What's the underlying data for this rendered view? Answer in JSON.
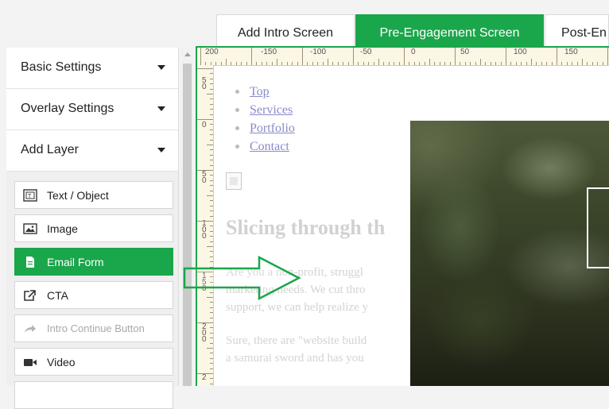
{
  "tabs": [
    {
      "label": "Add Intro Screen",
      "active": false
    },
    {
      "label": "Pre-Engagement Screen",
      "active": true
    },
    {
      "label": "Post-En",
      "active": false
    }
  ],
  "sidebar": {
    "sections": [
      {
        "label": "Basic Settings"
      },
      {
        "label": "Overlay Settings"
      },
      {
        "label": "Add Layer"
      }
    ],
    "layers": [
      {
        "label": "Text / Object",
        "icon": "text-object-icon",
        "state": "normal"
      },
      {
        "label": "Image",
        "icon": "image-icon",
        "state": "normal"
      },
      {
        "label": "Email Form",
        "icon": "form-document-icon",
        "state": "active"
      },
      {
        "label": "CTA",
        "icon": "external-link-icon",
        "state": "normal"
      },
      {
        "label": "Intro Continue Button",
        "icon": "share-arrow-icon",
        "state": "disabled"
      },
      {
        "label": "Video",
        "icon": "video-camera-icon",
        "state": "normal"
      }
    ]
  },
  "ruler": {
    "top_labels": [
      "200",
      "-150",
      "-100",
      "-50",
      "0",
      "50",
      "100",
      "150"
    ],
    "left_labels": [
      "5\n0",
      "0",
      "5\n0",
      "1\n0\n0",
      "1\n5\n0",
      "2\n0\n0",
      "2"
    ]
  },
  "page": {
    "nav": [
      "Top",
      "Services",
      "Portfolio",
      "Contact"
    ],
    "headline": "Slicing through th",
    "paragraph1": [
      "Are you a non-profit, struggl",
      "marketing needs. We cut thro",
      "support, we can help realize y"
    ],
    "paragraph2": [
      "Sure, there are \"website build",
      "a samurai sword and has you"
    ]
  },
  "colors": {
    "accent": "#1aa64a",
    "link": "#8a89c9",
    "muted_text": "#d1d1d1"
  }
}
